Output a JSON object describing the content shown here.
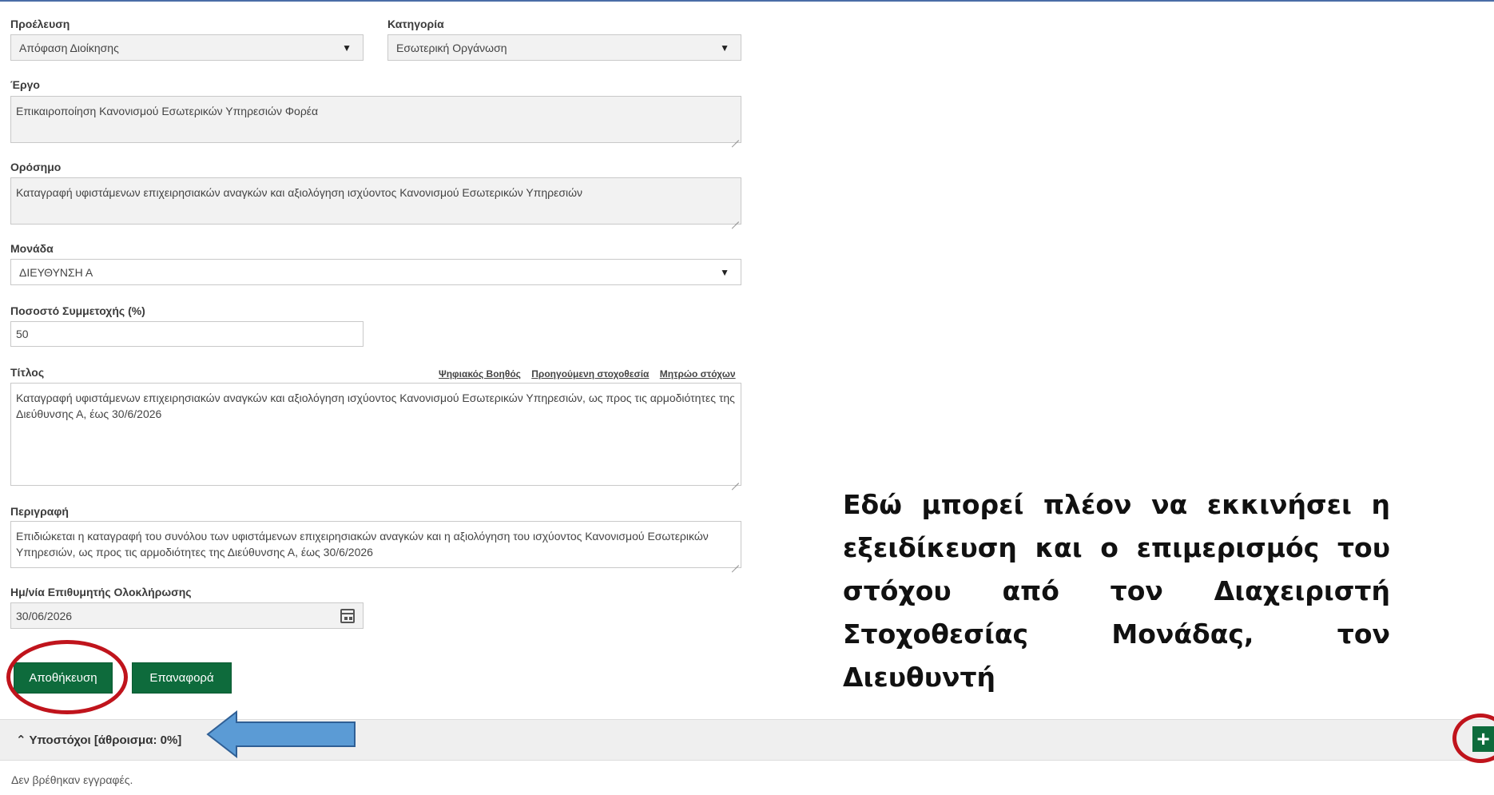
{
  "form": {
    "origin": {
      "label": "Προέλευση",
      "value": "Απόφαση Διοίκησης"
    },
    "category": {
      "label": "Κατηγορία",
      "value": "Εσωτερική Οργάνωση"
    },
    "project": {
      "label": "Έργο",
      "value": "Επικαιροποίηση Κανονισμού Εσωτερικών Υπηρεσιών Φορέα"
    },
    "milestone": {
      "label": "Ορόσημο",
      "value": "Καταγραφή υφιστάμενων επιχειρησιακών αναγκών και αξιολόγηση ισχύοντος Κανονισμού Εσωτερικών Υπηρεσιών"
    },
    "unit": {
      "label": "Μονάδα",
      "value": "ΔΙΕΥΘΥΝΣΗ Α"
    },
    "participation": {
      "label": "Ποσοστό Συμμετοχής (%)",
      "value": "50"
    },
    "title": {
      "label": "Τίτλος",
      "value": "Καταγραφή υφιστάμενων επιχειρησιακών αναγκών και αξιολόγηση ισχύοντος Κανονισμού Εσωτερικών Υπηρεσιών, ως προς τις αρμοδιότητες της Διεύθυνσης Α, έως 30/6/2026"
    },
    "description": {
      "label": "Περιγραφή",
      "value": "Επιδιώκεται η καταγραφή του συνόλου των υφιστάμενων επιχειρησιακών αναγκών και η αξιολόγηση του ισχύοντος Κανονισμού Εσωτερικών Υπηρεσιών, ως προς τις αρμοδιότητες της Διεύθυνσης Α, έως 30/6/2026"
    },
    "due_date": {
      "label": "Ημ/νία Επιθυμητής Ολοκλήρωσης",
      "value": "30/06/2026"
    }
  },
  "title_links": {
    "assistant": "Ψηφιακός Βοηθός",
    "previous": "Προηγούμενη στοχοθεσία",
    "registry": "Μητρώο στόχων"
  },
  "buttons": {
    "save": "Αποθήκευση",
    "reset": "Επαναφορά",
    "add": "+"
  },
  "subgoals": {
    "title": "⌃ Υποστόχοι [άθροισμα: 0%]",
    "empty": "Δεν βρέθηκαν εγγραφές."
  },
  "callout": "Εδώ μπορεί πλέον να εκκινήσει η εξειδίκευση και ο επιμερισμός του στόχου από τον Διαχειριστή Στοχοθεσίας Μονάδας, τον Διευθυντή",
  "colors": {
    "primary_green": "#0e6b3c",
    "highlight_red": "#c0141c",
    "arrow_blue": "#5b9bd5"
  },
  "icons": {
    "select": "triangle-down-icon",
    "date": "calendar-icon",
    "collapse": "chevron-up-icon",
    "add": "plus-icon"
  }
}
